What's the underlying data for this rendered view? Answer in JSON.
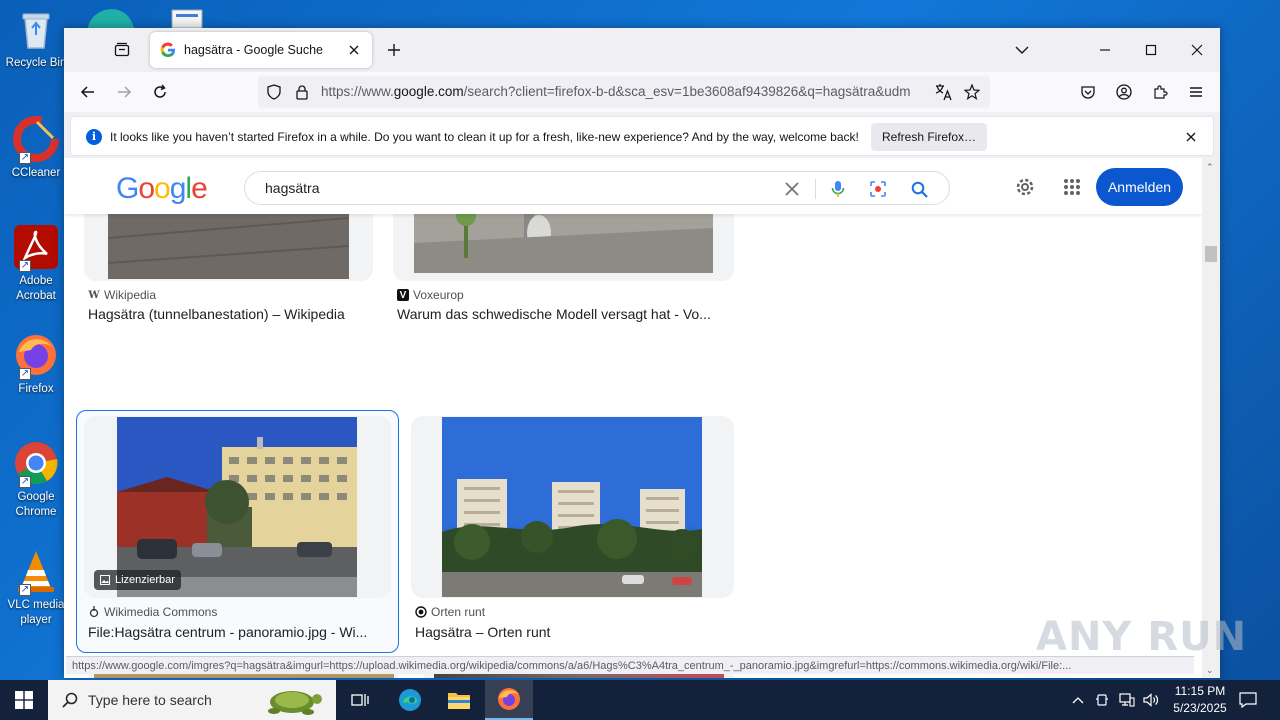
{
  "desktop": {
    "icons": [
      {
        "label": "Recycle Bin"
      },
      {
        "label": "CCleaner"
      },
      {
        "label": "Adobe Acrobat"
      },
      {
        "label": "Firefox"
      },
      {
        "label": "Google Chrome"
      },
      {
        "label": "VLC media player"
      }
    ]
  },
  "browser": {
    "tab": {
      "title": "hagsätra - Google Suche"
    },
    "url": {
      "prefix": "https://www.",
      "host": "google.com",
      "rest": "/search?client=firefox-b-d&sca_esv=1be3608af9439826&q=hagsätra&udm"
    },
    "notice": {
      "message": "It looks like you haven’t started Firefox in a while. Do you want to clean it up for a fresh, like-new experience? And by the way, welcome back!",
      "button": "Refresh Firefox…"
    },
    "status_url": "https://www.google.com/imgres?q=hagsätra&imgurl=https://upload.wikimedia.org/wikipedia/commons/a/a6/Hags%C3%A4tra_centrum_-_panoramio.jpg&imgrefurl=https://commons.wikimedia.org/wiki/File:..."
  },
  "google": {
    "logo": [
      "G",
      "o",
      "o",
      "g",
      "l",
      "e"
    ],
    "logo_colors": [
      "#4285f4",
      "#ea4335",
      "#fbbc05",
      "#4285f4",
      "#34a853",
      "#ea4335"
    ],
    "query": "hagsätra",
    "signin": "Anmelden",
    "results": [
      {
        "source": "Wikipedia",
        "title": "Hagsätra (tunnelbanestation) – Wikipedia"
      },
      {
        "source": "Voxeurop",
        "title": "Warum das schwedische Modell versagt hat - Vo..."
      },
      {
        "source": "Wikimedia Commons",
        "title": "File:Hagsätra centrum - panoramio.jpg - Wi...",
        "badge": "Lizenzierbar"
      },
      {
        "source": "Orten runt",
        "title": "Hagsätra – Orten runt"
      }
    ]
  },
  "taskbar": {
    "search_placeholder": "Type here to search",
    "time": "11:15 PM",
    "date": "5/23/2025"
  },
  "watermark": "ANY RUN"
}
